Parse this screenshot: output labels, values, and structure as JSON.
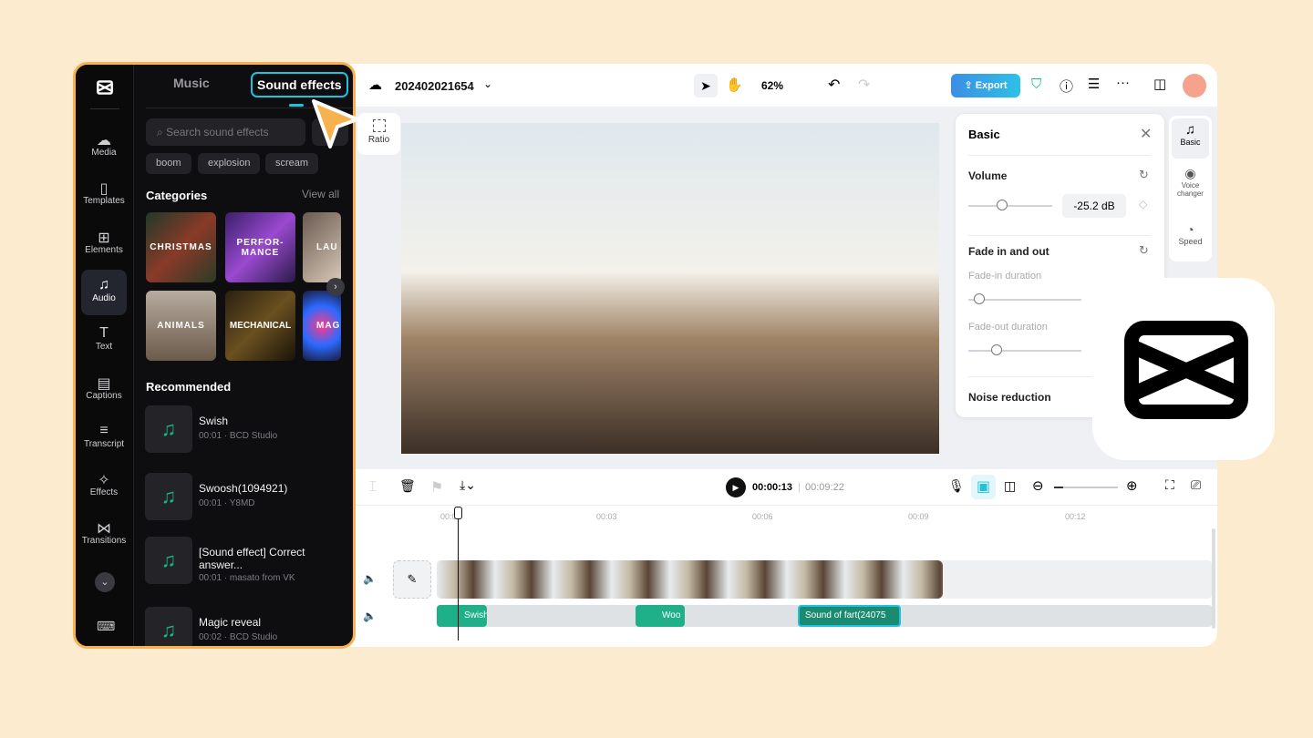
{
  "sidebar": {
    "items": [
      {
        "label": "Media",
        "icon": "cloud-upload-icon"
      },
      {
        "label": "Templates",
        "icon": "templates-icon"
      },
      {
        "label": "Elements",
        "icon": "elements-icon"
      },
      {
        "label": "Audio",
        "icon": "music-note-icon",
        "active": true
      },
      {
        "label": "Text",
        "icon": "text-icon"
      },
      {
        "label": "Captions",
        "icon": "captions-icon"
      },
      {
        "label": "Transcript",
        "icon": "transcript-icon"
      },
      {
        "label": "Effects",
        "icon": "effects-icon"
      },
      {
        "label": "Transitions",
        "icon": "transitions-icon"
      }
    ]
  },
  "panel": {
    "tabs": [
      "Music",
      "Sound effects"
    ],
    "active_tab": "Sound effects",
    "search_placeholder": "Search sound effects",
    "chips": [
      "boom",
      "explosion",
      "scream"
    ],
    "categories_title": "Categories",
    "view_all": "View all",
    "categories": [
      "CHRISTMAS",
      "PERFOR-\nMANCE",
      "LAU",
      "ANIMALS",
      "MECHANICAL",
      "MAG"
    ],
    "recommended_title": "Recommended",
    "recommended": [
      {
        "title": "Swish",
        "meta": "00:01 · BCD Studio"
      },
      {
        "title": "Swoosh(1094921)",
        "meta": "00:01 · Y8MD"
      },
      {
        "title": "[Sound effect] Correct answer...",
        "meta": "00:01 · masato from VK"
      },
      {
        "title": "Magic reveal",
        "meta": "00:02 · BCD Studio"
      }
    ]
  },
  "topbar": {
    "project_name": "202402021654",
    "zoom": "62%",
    "export_label": "Export"
  },
  "canvas": {
    "ratio_label": "Ratio"
  },
  "basic_panel": {
    "title": "Basic",
    "volume_label": "Volume",
    "volume_value": "-25.2 dB",
    "volume_level": 0.4,
    "fade_title": "Fade in and out",
    "fade_in_label": "Fade-in duration",
    "fade_in_level": 0.1,
    "fade_out_label": "Fade-out duration",
    "fade_out_level": 0.25,
    "noise_label": "Noise reduction"
  },
  "right_tabs": [
    {
      "label": "Basic",
      "icon": "music-note-icon"
    },
    {
      "label": "Voice changer",
      "icon": "voice-changer-icon"
    },
    {
      "label": "Speed",
      "icon": "speed-icon"
    }
  ],
  "timeline": {
    "current_time": "00:00:13",
    "total_time": "00:09:22",
    "ticks": [
      "00:00",
      "00:03",
      "00:06",
      "00:09",
      "00:12"
    ],
    "audio_clips": [
      "Swish",
      "Woo",
      "Sound of fart(24075"
    ]
  },
  "colors": {
    "accent": "#1fc1dc",
    "export": "#3a8ee6",
    "audio_clip": "#1fb08a",
    "highlight": "#f7b24f",
    "background": "#fdebd0"
  }
}
